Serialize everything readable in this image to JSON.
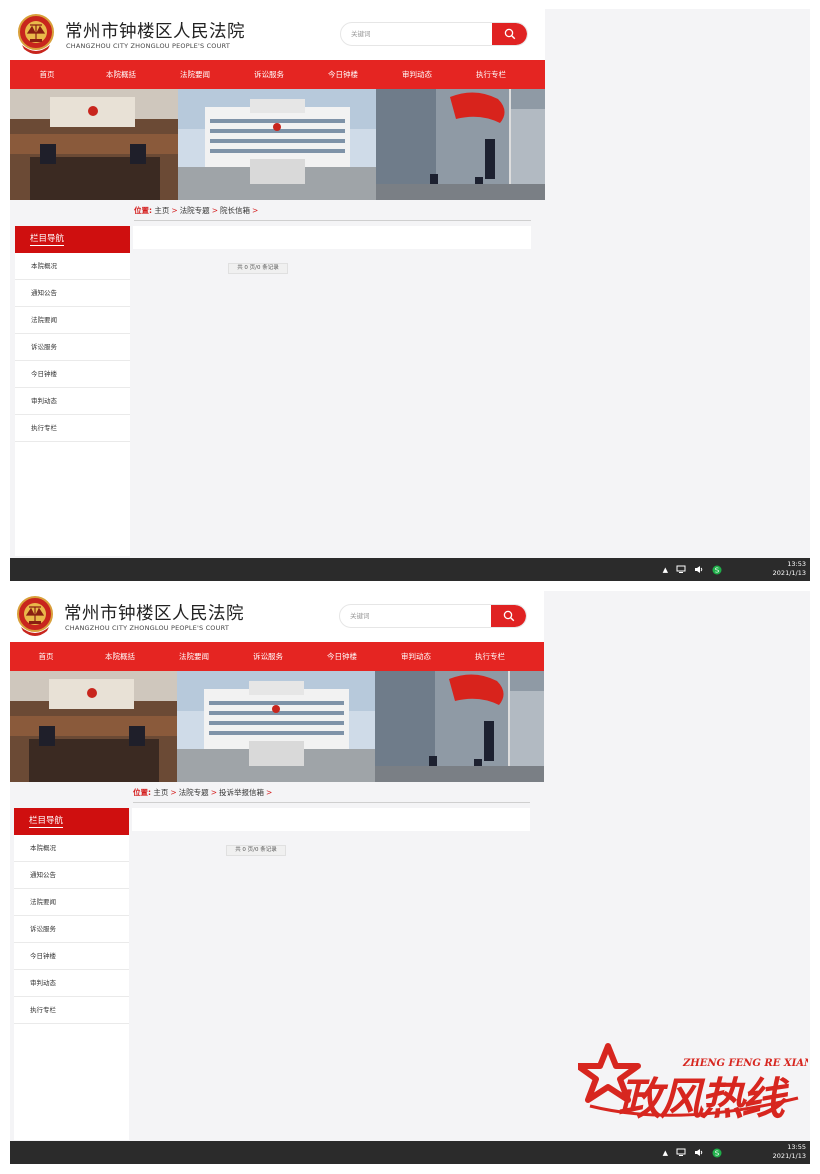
{
  "site": {
    "title_cn": "常州市钟楼区人民法院",
    "title_en": "CHANGZHOU CITY ZHONGLOU PEOPLE'S COURT",
    "search_placeholder": "关键词"
  },
  "nav": [
    "首页",
    "本院概括",
    "法院要闻",
    "诉讼服务",
    "今日钟楼",
    "审判动态",
    "执行专栏"
  ],
  "breadcrumb": {
    "label": "位置:",
    "home": "主页",
    "section": "法院专题",
    "shot1_page": "院长信箱",
    "shot2_page": "投诉举报信箱"
  },
  "sidebar": {
    "heading": "栏目导航",
    "items": [
      "本院概况",
      "通知公告",
      "法院要闻",
      "诉讼服务",
      "今日钟楼",
      "审判动态",
      "执行专栏"
    ]
  },
  "pager": "共 0 页/0 条记录",
  "taskbar": {
    "shot1_time": "13:53",
    "shot2_time": "13:55",
    "date": "2021/1/13"
  },
  "watermark": {
    "pinyin": "ZHENG FENG RE XIAN",
    "text": "政风热线"
  },
  "colors": {
    "brand_red": "#e52522",
    "sidebar_red": "#cf0f0f",
    "page_bg": "#f4f4f6",
    "taskbar": "#2b2b2b"
  },
  "icons": [
    "court-emblem-icon",
    "search-icon",
    "chevron-up-icon",
    "network-icon",
    "volume-icon",
    "app-s-icon"
  ]
}
